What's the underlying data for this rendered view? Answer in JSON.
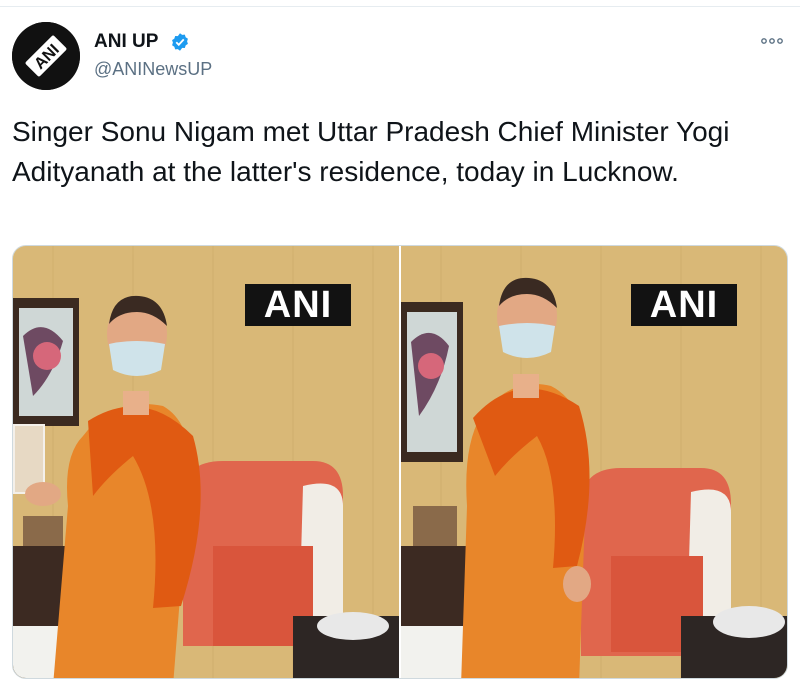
{
  "tweet": {
    "display_name": "ANI UP",
    "handle": "@ANINewsUP",
    "text": "Singer Sonu Nigam met Uttar Pradesh Chief Minister Yogi Adityanath at the latter's residence, today in Lucknow.",
    "avatar_text": "ANI"
  },
  "media": {
    "watermark_left": "ANI",
    "watermark_right": "ANI"
  },
  "icons": {
    "verified": "verified-badge-icon",
    "more": "more-options-icon"
  },
  "colors": {
    "verified": "#1d9bf0",
    "secondary_text": "#5b7083",
    "robe": "#e8862a",
    "shawl": "#e05a12",
    "wall": "#d9b877",
    "sofa": "#e0664d"
  }
}
